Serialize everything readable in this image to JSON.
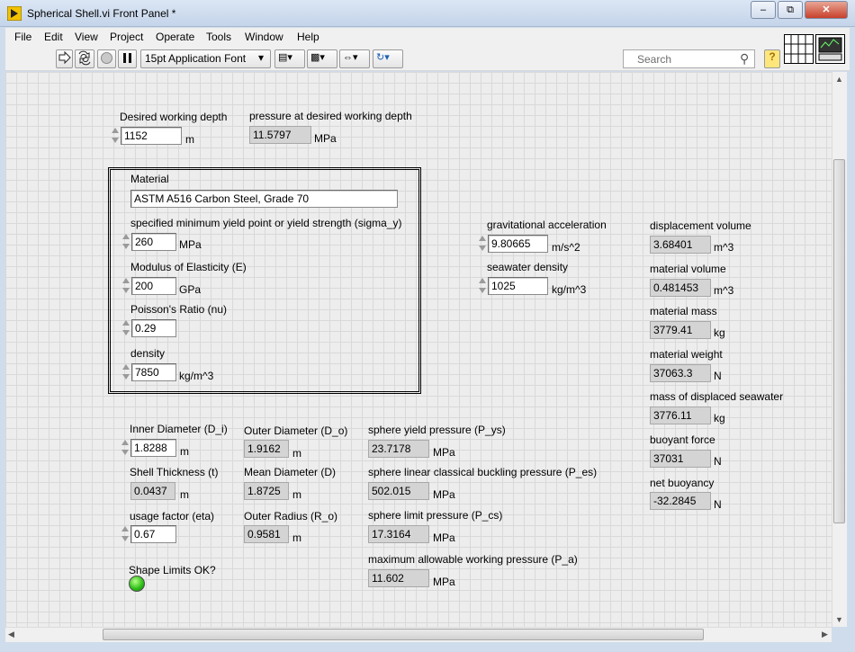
{
  "window": {
    "title": "Spherical Shell.vi Front Panel *",
    "controls": {
      "minimize": "–",
      "restore": "⧉",
      "close": "✕"
    }
  },
  "menu": [
    "File",
    "Edit",
    "View",
    "Project",
    "Operate",
    "Tools",
    "Window",
    "Help"
  ],
  "toolbar": {
    "run_icon": "run-arrow-icon",
    "font": "15pt Application Font",
    "search_placeholder": "Search",
    "help_glyph": "?"
  },
  "panel": {
    "desired_depth": {
      "label": "Desired working depth",
      "value": "1152",
      "unit": "m"
    },
    "pressure_at_depth": {
      "label": "pressure at desired working depth",
      "value": "11.5797",
      "unit": "MPa"
    },
    "material": {
      "label": "Material",
      "value": "ASTM A516 Carbon Steel, Grade 70",
      "yield": {
        "label": "specified minimum yield point or yield strength (sigma_y)",
        "value": "260",
        "unit": "MPa"
      },
      "modulus": {
        "label": "Modulus of Elasticity (E)",
        "value": "200",
        "unit": "GPa"
      },
      "poisson": {
        "label": "Poisson's Ratio (nu)",
        "value": "0.29"
      },
      "density": {
        "label": "density",
        "value": "7850",
        "unit": "kg/m^3"
      }
    },
    "gravity": {
      "label": "gravitational acceleration",
      "value": "9.80665",
      "unit": "m/s^2"
    },
    "seawater_density": {
      "label": "seawater density",
      "value": "1025",
      "unit": "kg/m^3"
    },
    "displacement_volume": {
      "label": "displacement volume",
      "value": "3.68401",
      "unit": "m^3"
    },
    "material_volume": {
      "label": "material volume",
      "value": "0.481453",
      "unit": "m^3"
    },
    "material_mass": {
      "label": "material mass",
      "value": "3779.41",
      "unit": "kg"
    },
    "material_weight": {
      "label": "material weight",
      "value": "37063.3",
      "unit": "N"
    },
    "displaced_mass": {
      "label": "mass of displaced seawater",
      "value": "3776.11",
      "unit": "kg"
    },
    "buoyant_force": {
      "label": "buoyant force",
      "value": "37031",
      "unit": "N"
    },
    "net_buoyancy": {
      "label": "net buoyancy",
      "value": "-32.2845",
      "unit": "N"
    },
    "inner_diameter": {
      "label": "Inner Diameter (D_i)",
      "value": "1.8288",
      "unit": "m"
    },
    "outer_diameter": {
      "label": "Outer Diameter (D_o)",
      "value": "1.9162",
      "unit": "m"
    },
    "shell_thickness": {
      "label": "Shell Thickness (t)",
      "value": "0.0437",
      "unit": "m"
    },
    "mean_diameter": {
      "label": "Mean Diameter (D)",
      "value": "1.8725",
      "unit": "m"
    },
    "usage_factor": {
      "label": "usage factor (eta)",
      "value": "0.67"
    },
    "outer_radius": {
      "label": "Outer Radius (R_o)",
      "value": "0.9581",
      "unit": "m"
    },
    "yield_pressure": {
      "label": "sphere yield pressure (P_ys)",
      "value": "23.7178",
      "unit": "MPa"
    },
    "buckling_pressure": {
      "label": "sphere linear classical buckling pressure (P_es)",
      "value": "502.015",
      "unit": "MPa"
    },
    "limit_pressure": {
      "label": "sphere limit pressure (P_cs)",
      "value": "17.3164",
      "unit": "MPa"
    },
    "max_pressure": {
      "label": "maximum allowable working pressure (P_a)",
      "value": "11.602",
      "unit": "MPa"
    },
    "shape_ok": {
      "label": "Shape Limits OK?",
      "state": true,
      "color": "#31c21a"
    }
  }
}
